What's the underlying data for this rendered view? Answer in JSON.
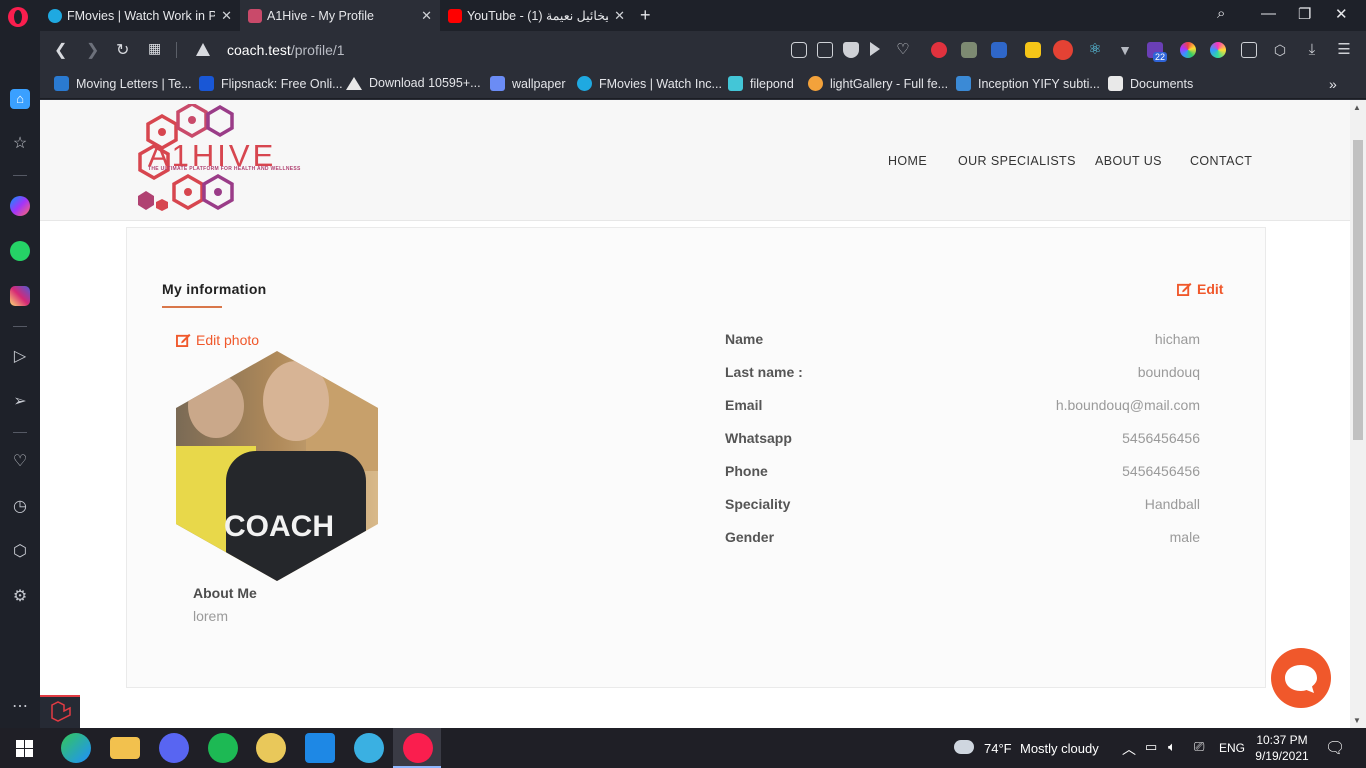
{
  "browser": {
    "tabs": [
      {
        "label": "FMovies | Watch Work in Pr",
        "favicon_color": "#1fa9e1",
        "active": false
      },
      {
        "label": "A1Hive - My Profile",
        "favicon_color": "#c94a6a",
        "active": true
      },
      {
        "label": "YouTube - ميخائيل نعيمة (1)",
        "favicon_color": "#ff0000",
        "active": false
      }
    ],
    "url_host": "coach.test",
    "url_path": "/profile/1",
    "extension_badge": "22",
    "bookmarks": [
      {
        "label": "Moving Letters | Te...",
        "color": "#2a7ad1"
      },
      {
        "label": "Flipsnack: Free Onli...",
        "color": "#1957d6"
      },
      {
        "label": "Download 10595+...",
        "color": "#e9e9e9"
      },
      {
        "label": "wallpaper",
        "color": "#6b8cf5"
      },
      {
        "label": "FMovies | Watch Inc...",
        "color": "#1fa9e1"
      },
      {
        "label": "filepond",
        "color": "#43c6d7"
      },
      {
        "label": "lightGallery - Full fe...",
        "color": "#f3a23b"
      },
      {
        "label": "Inception YIFY subti...",
        "color": "#3b8ad6"
      },
      {
        "label": "Documents",
        "color": "#e9e9e9"
      }
    ]
  },
  "site": {
    "nav": [
      "HOME",
      "OUR SPECIALISTS",
      "ABOUT US",
      "CONTACT"
    ],
    "logo_text": "A1HIVE",
    "logo_tagline": "THE ULTIMATE PLATFORM FOR HEALTH AND WELLNESS"
  },
  "profile": {
    "section_title": "My information",
    "edit_label": "Edit",
    "edit_photo_label": "Edit photo",
    "photo_caption": "COACH",
    "about_heading": "About Me",
    "about_text": "lorem",
    "fields": [
      {
        "label": "Name",
        "value": "hicham"
      },
      {
        "label": "Last name :",
        "value": "boundouq"
      },
      {
        "label": "Email",
        "value": "h.boundouq@mail.com"
      },
      {
        "label": "Whatsapp",
        "value": "5456456456"
      },
      {
        "label": "Phone",
        "value": "5456456456"
      },
      {
        "label": "Speciality",
        "value": "Handball"
      },
      {
        "label": "Gender",
        "value": "male"
      }
    ]
  },
  "taskbar": {
    "weather_temp": "74°F",
    "weather_desc": "Mostly cloudy",
    "language": "ENG",
    "time": "10:37 PM",
    "date": "9/19/2021"
  },
  "colors": {
    "accent": "#f0582b",
    "opera_red": "#fa1e4e"
  }
}
